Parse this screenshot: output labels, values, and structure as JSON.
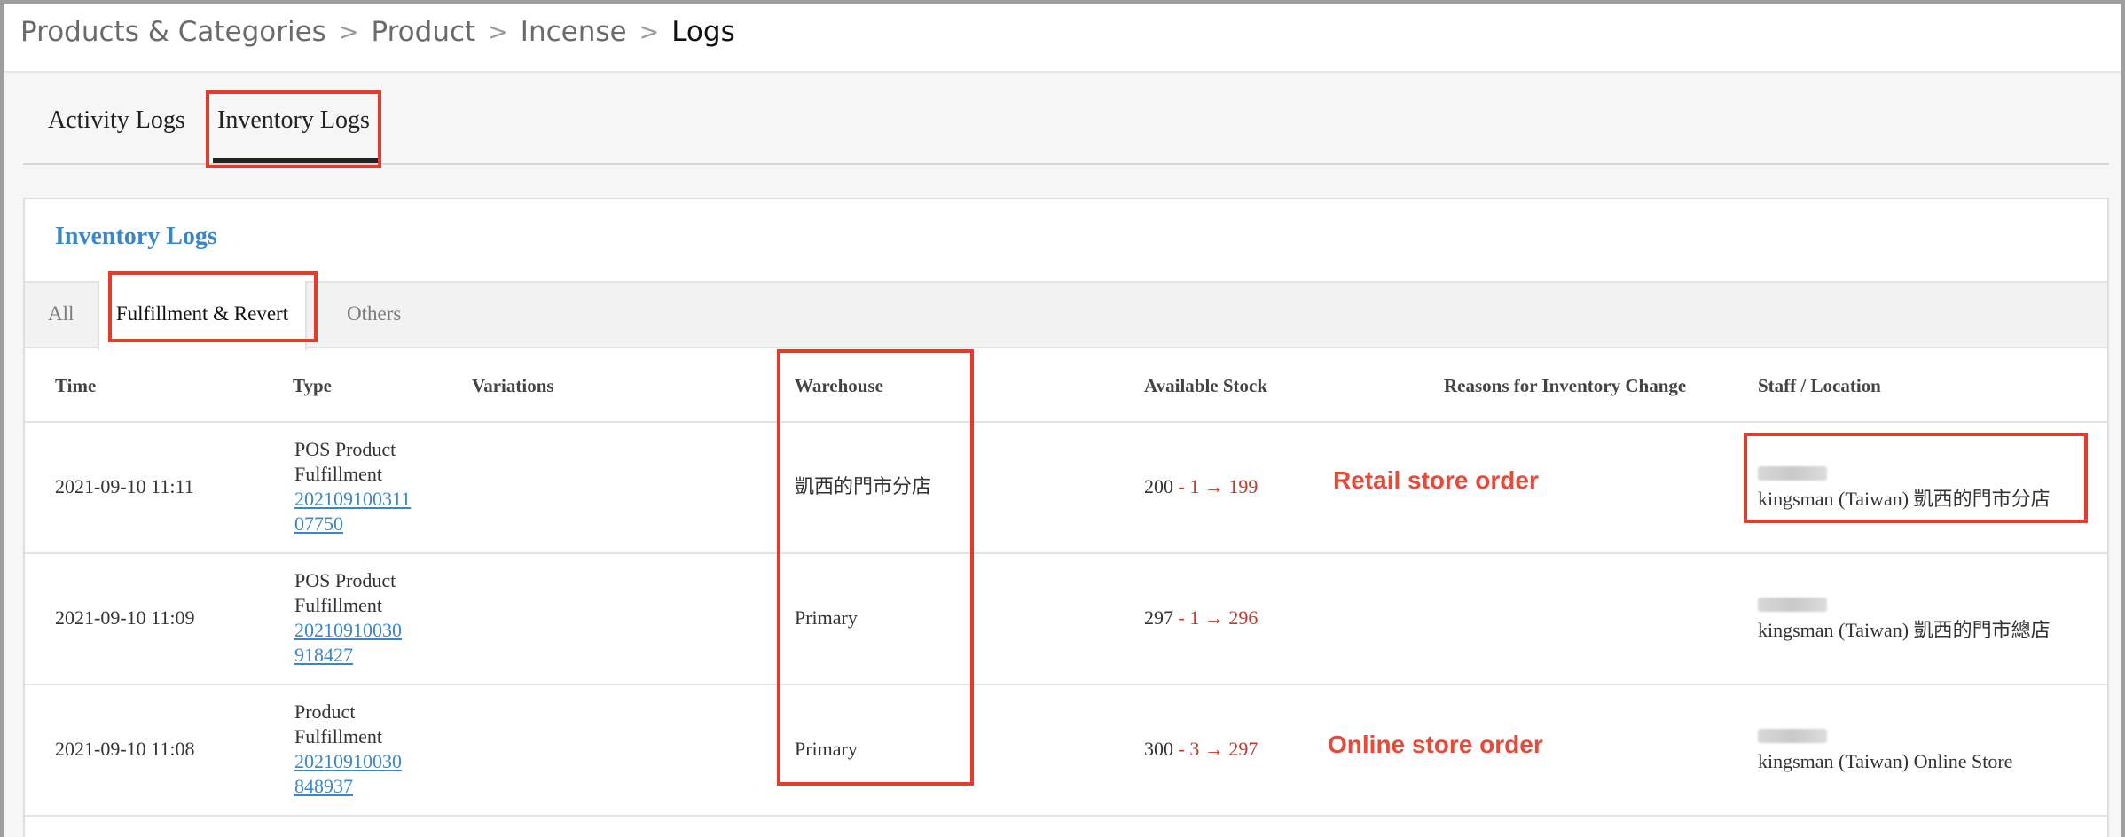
{
  "breadcrumb": {
    "items": [
      "Products & Categories",
      "Product",
      "Incense",
      "Logs"
    ],
    "separator": ">"
  },
  "top_tabs": {
    "activity": "Activity Logs",
    "inventory": "Inventory Logs"
  },
  "card": {
    "title": "Inventory Logs",
    "sub_tabs": {
      "all": "All",
      "fulfillment": "Fulfillment & Revert",
      "others": "Others"
    },
    "columns": {
      "time": "Time",
      "type": "Type",
      "variations": "Variations",
      "warehouse": "Warehouse",
      "available_stock": "Available Stock",
      "reasons": "Reasons for Inventory Change",
      "staff_location": "Staff / Location"
    },
    "rows": [
      {
        "time": "2021-09-10 11:11",
        "type_line1": "POS Product",
        "type_line2": "Fulfillment",
        "order_line1": "202109100311",
        "order_line2": "07750",
        "warehouse": "凱西的門市分店",
        "stock_before": "200",
        "stock_minus": "- 1",
        "stock_arrow": "→",
        "stock_after": "199",
        "location": "kingsman (Taiwan) 凱西的門市分店"
      },
      {
        "time": "2021-09-10 11:09",
        "type_line1": "POS Product",
        "type_line2": "Fulfillment",
        "order_line1": "20210910030",
        "order_line2": "918427",
        "warehouse": "Primary",
        "stock_before": "297",
        "stock_minus": "- 1",
        "stock_arrow": "→",
        "stock_after": "296",
        "location": "kingsman (Taiwan) 凱西的門市總店"
      },
      {
        "time": "2021-09-10 11:08",
        "type_line1": "Product",
        "type_line2": "Fulfillment",
        "order_line1": "20210910030",
        "order_line2": "848937",
        "warehouse": "Primary",
        "stock_before": "300",
        "stock_minus": "- 3",
        "stock_arrow": "→",
        "stock_after": "297",
        "location": "kingsman (Taiwan) Online Store"
      }
    ]
  },
  "annotations": {
    "retail": "Retail store order",
    "online": "Online store order",
    "highlight_color": "#e53b2c"
  }
}
